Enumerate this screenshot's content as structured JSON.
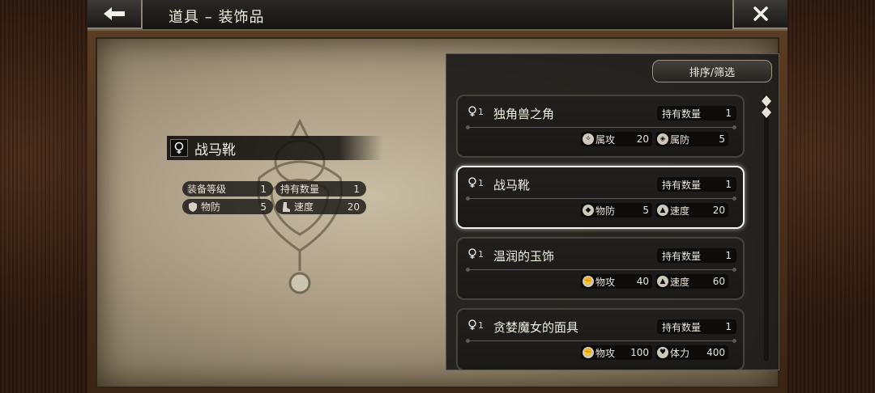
{
  "header": {
    "title": "道具 – 装饰品"
  },
  "toolbar": {
    "sort_label": "排序/筛选"
  },
  "detail": {
    "name": "战马靴",
    "stats": [
      {
        "label": "装备等级",
        "value": "1",
        "icon": "none"
      },
      {
        "label": "持有数量",
        "value": "1",
        "icon": "none"
      },
      {
        "label": "物防",
        "value": "5",
        "icon": "shield-icon"
      },
      {
        "label": "速度",
        "value": "20",
        "icon": "boot-icon"
      }
    ]
  },
  "list": {
    "have_label": "持有数量",
    "items": [
      {
        "quality": "1",
        "name": "独角兽之角",
        "have": "1",
        "stats": [
          {
            "label": "属攻",
            "value": "20",
            "icon": "magic-attack-icon"
          },
          {
            "label": "属防",
            "value": "5",
            "icon": "magic-defense-icon"
          }
        ]
      },
      {
        "quality": "1",
        "name": "战马靴",
        "have": "1",
        "stats": [
          {
            "label": "物防",
            "value": "5",
            "icon": "shield-icon"
          },
          {
            "label": "速度",
            "value": "20",
            "icon": "boot-icon"
          }
        ]
      },
      {
        "quality": "1",
        "name": "温润的玉饰",
        "have": "1",
        "stats": [
          {
            "label": "物攻",
            "value": "40",
            "icon": "fist-icon"
          },
          {
            "label": "速度",
            "value": "60",
            "icon": "boot-icon"
          }
        ]
      },
      {
        "quality": "1",
        "name": "贪婪魔女的面具",
        "have": "1",
        "stats": [
          {
            "label": "物攻",
            "value": "100",
            "icon": "fist-icon"
          },
          {
            "label": "体力",
            "value": "400",
            "icon": "heart-icon"
          }
        ]
      }
    ]
  },
  "colors": {
    "selected_border": "#f4f2ec",
    "panel_bg": "#1c1b19"
  }
}
